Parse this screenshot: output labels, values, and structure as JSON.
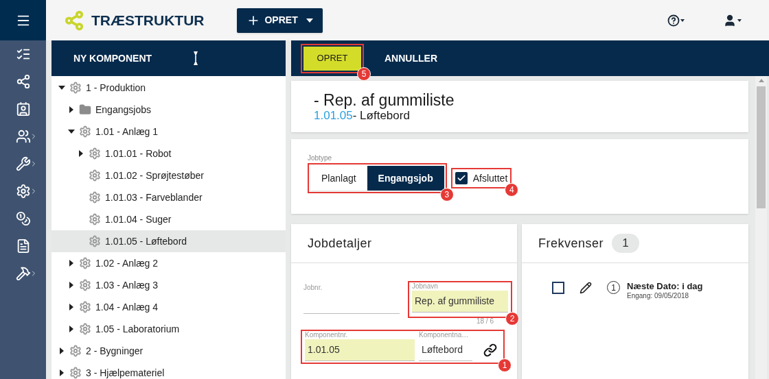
{
  "sidebar": {
    "items": [
      {
        "submenu": false,
        "selected": true
      },
      {
        "submenu": false,
        "selected": false
      },
      {
        "submenu": false,
        "selected": false
      },
      {
        "submenu": false,
        "selected": false
      },
      {
        "submenu": true,
        "selected": false
      },
      {
        "submenu": true,
        "selected": false
      },
      {
        "submenu": true,
        "selected": false
      },
      {
        "submenu": false,
        "selected": false
      },
      {
        "submenu": false,
        "selected": false
      },
      {
        "submenu": true,
        "selected": false
      }
    ]
  },
  "header": {
    "title": "TRÆSTRUKTUR",
    "create_button": "OPRET"
  },
  "tree_panel": {
    "new_button": "NY KOMPONENT",
    "nodes": [
      {
        "label": "1 - Produktion",
        "kind": "component",
        "expanded": true,
        "selected": false,
        "children": [
          {
            "label": "Engangsjobs",
            "kind": "folder",
            "expanded": false,
            "selected": false
          },
          {
            "label": "1.01 - Anlæg 1",
            "kind": "component",
            "expanded": true,
            "selected": false,
            "children": [
              {
                "label": "1.01.01 - Robot",
                "kind": "component",
                "expanded": false,
                "selected": false
              },
              {
                "label": "1.01.02 - Sprøjtestøber",
                "kind": "component",
                "selected": false
              },
              {
                "label": "1.01.03 - Farveblander",
                "kind": "component",
                "selected": false
              },
              {
                "label": "1.01.04 - Suger",
                "kind": "component",
                "selected": false
              },
              {
                "label": "1.01.05 - Løftebord",
                "kind": "component",
                "selected": true
              }
            ]
          },
          {
            "label": "1.02 - Anlæg 2",
            "kind": "component",
            "expanded": false,
            "selected": false
          },
          {
            "label": "1.03 - Anlæg 3",
            "kind": "component",
            "expanded": false,
            "selected": false
          },
          {
            "label": "1.04 - Anlæg 4",
            "kind": "component",
            "expanded": false,
            "selected": false
          },
          {
            "label": "1.05 - Laboratorium",
            "kind": "component",
            "expanded": false,
            "selected": false
          }
        ]
      },
      {
        "label": "2 - Bygninger",
        "kind": "component",
        "expanded": false,
        "selected": false
      },
      {
        "label": "3 - Hjælpemateriel",
        "kind": "component",
        "expanded": false,
        "selected": false
      }
    ]
  },
  "action_bar": {
    "save_button": "OPRET",
    "save_marker": "5",
    "cancel_button": "ANNULLER"
  },
  "title_card": {
    "title": "- Rep. af gummiliste",
    "component_number": "1.01.05",
    "component_name": "- Løftebord"
  },
  "jobtype": {
    "label": "Jobtype",
    "marker": "3",
    "options": [
      {
        "label": "Planlagt",
        "selected": false
      },
      {
        "label": "Engangsjob",
        "selected": true
      }
    ],
    "finished": {
      "label": "Afsluttet",
      "checked": true,
      "marker": "4"
    }
  },
  "job_details": {
    "title": "Jobdetaljer",
    "job_number": {
      "label": "Jobnr.",
      "highlighted": false
    },
    "job_name": {
      "label": "Jobnavn",
      "value": "Rep. af gummiliste",
      "highlighted": true,
      "counter": "18 / 6",
      "marker": "2"
    },
    "component_marker": "1",
    "component_number": {
      "label": "Komponentnr.",
      "value": "1.01.05",
      "highlighted": true
    },
    "component_name": {
      "label": "Komponentna…",
      "value": "Løftebord",
      "highlighted": false
    }
  },
  "frequencies": {
    "title": "Frekvenser",
    "count": "1",
    "items": [
      {
        "checked": false,
        "index": "1",
        "title": "Næste Dato: i dag",
        "subtitle": "Engang: 09/05/2018"
      }
    ]
  }
}
